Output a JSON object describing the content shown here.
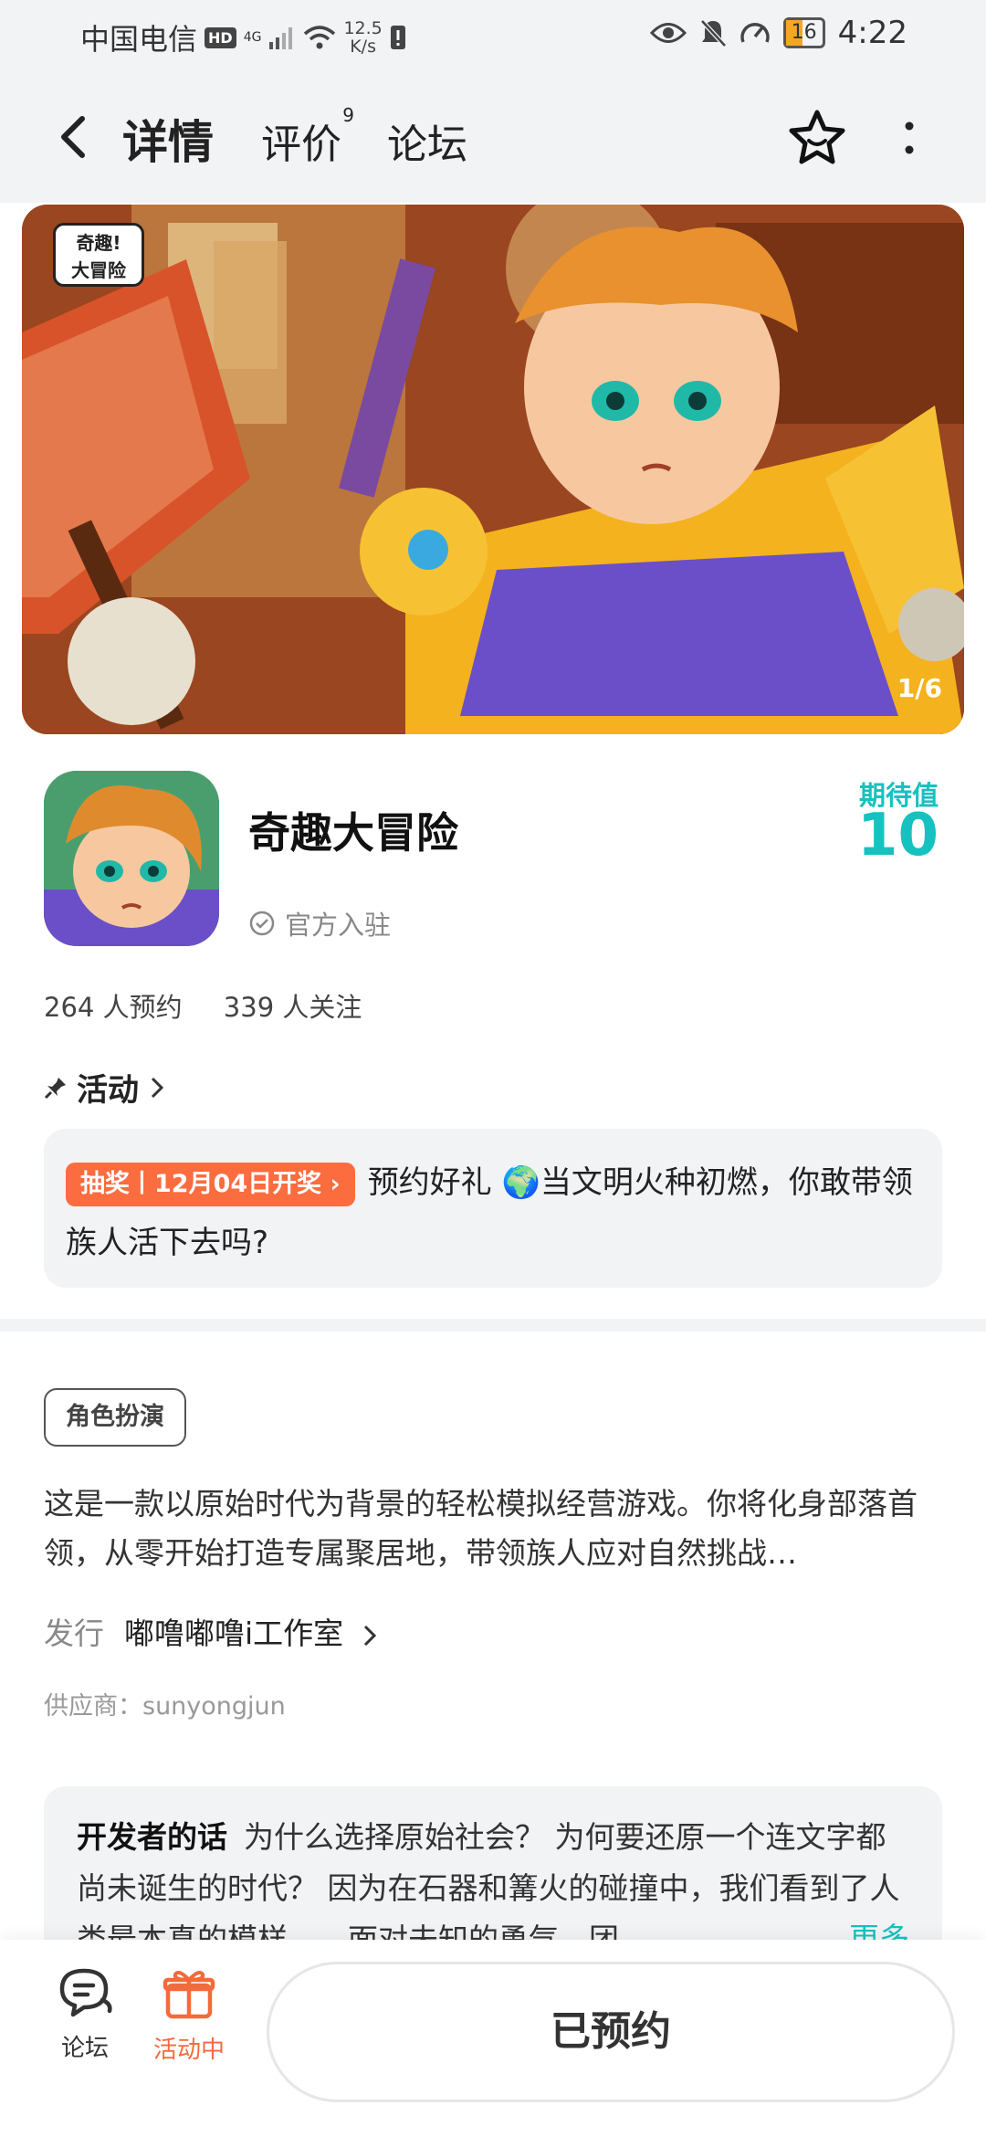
{
  "status_bar": {
    "carrier": "中国电信",
    "hd": "HD",
    "signal": "4G",
    "speed_value": "12.5",
    "speed_unit": "K/s",
    "battery": "16",
    "time": "4:22"
  },
  "nav": {
    "tabs": [
      {
        "label": "详情",
        "active": true
      },
      {
        "label": "评价",
        "badge": "9"
      },
      {
        "label": "论坛"
      }
    ]
  },
  "banner": {
    "counter": "1/6",
    "logo_text": "奇趣!大冒险"
  },
  "app": {
    "name": "奇趣大冒险",
    "official_label": "官方入驻",
    "expect_label": "期待值",
    "expect_value": "10",
    "reservations": "264 人预约",
    "followers": "339 人关注"
  },
  "activity": {
    "heading": "活动",
    "badge": "抽奖丨12月04日开奖",
    "text": "预约好礼 🌍当文明火种初燃，你敢带领族人活下去吗?"
  },
  "detail": {
    "genre": "角色扮演",
    "description": "这是一款以原始时代为背景的轻松模拟经营游戏。你将化身部落首领，从零开始打造专属聚居地，带领族人应对自然挑战…",
    "publisher_label": "发行",
    "publisher_value": "嘟噜嘟噜i工作室",
    "supplier": "供应商：sunyongjun"
  },
  "developer": {
    "title": "开发者的话",
    "text": "为什么选择原始社会？ 为何要还原一个连文字都尚未诞生的时代？ 因为在石器和篝火的碰撞中，我们看到了人类最本真的模样——面对未知的勇气，团",
    "more": "更多"
  },
  "bottom": {
    "forum_label": "论坛",
    "activity_label": "活动中",
    "reserve_label": "已预约"
  },
  "colors": {
    "accent": "#15c2bf",
    "orange": "#fb6c3f",
    "background": "#f2f3f5"
  }
}
